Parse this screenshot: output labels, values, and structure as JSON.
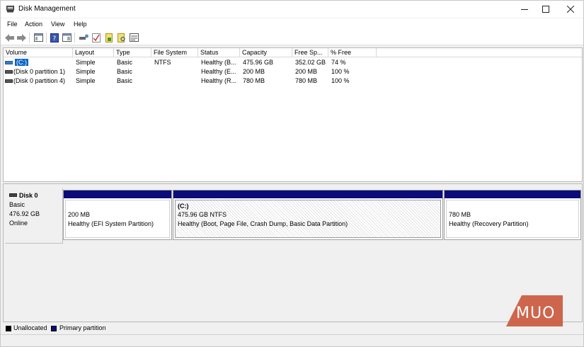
{
  "window": {
    "title": "Disk Management"
  },
  "menu": {
    "items": [
      "File",
      "Action",
      "View",
      "Help"
    ]
  },
  "toolbar": {
    "icons": [
      "back-icon",
      "forward-icon",
      "show-hide-console-tree-icon",
      "properties-icon",
      "help-icon",
      "view-icon",
      "connect-icon",
      "check-icon",
      "new-icon",
      "search-icon",
      "settings-icon"
    ]
  },
  "volumes": {
    "columns": [
      "Volume",
      "Layout",
      "Type",
      "File System",
      "Status",
      "Capacity",
      "Free Sp...",
      "% Free"
    ],
    "rows": [
      {
        "volume": "(C:)",
        "layout": "Simple",
        "type": "Basic",
        "fs": "NTFS",
        "status": "Healthy (B...",
        "capacity": "475.96 GB",
        "free": "352.02 GB",
        "pct": "74 %"
      },
      {
        "volume": "(Disk 0 partition 1)",
        "layout": "Simple",
        "type": "Basic",
        "fs": "",
        "status": "Healthy (E...",
        "capacity": "200 MB",
        "free": "200 MB",
        "pct": "100 %"
      },
      {
        "volume": "(Disk 0 partition 4)",
        "layout": "Simple",
        "type": "Basic",
        "fs": "",
        "status": "Healthy (R...",
        "capacity": "780 MB",
        "free": "780 MB",
        "pct": "100 %"
      }
    ]
  },
  "disk": {
    "name": "Disk 0",
    "type": "Basic",
    "size": "476.92 GB",
    "state": "Online",
    "partitions": [
      {
        "title": "",
        "size": "200 MB",
        "status": "Healthy (EFI System Partition)"
      },
      {
        "title": "(C:)",
        "size": "475.96 GB NTFS",
        "status": "Healthy (Boot, Page File, Crash Dump, Basic Data Partition)"
      },
      {
        "title": "",
        "size": "780 MB",
        "status": "Healthy (Recovery Partition)"
      }
    ]
  },
  "legend": {
    "unallocated": "Unallocated",
    "primary": "Primary partition",
    "unallocated_color": "#000000",
    "primary_color": "#0b0b7a"
  },
  "watermark": {
    "text": "MUO",
    "color": "#c9563a"
  }
}
